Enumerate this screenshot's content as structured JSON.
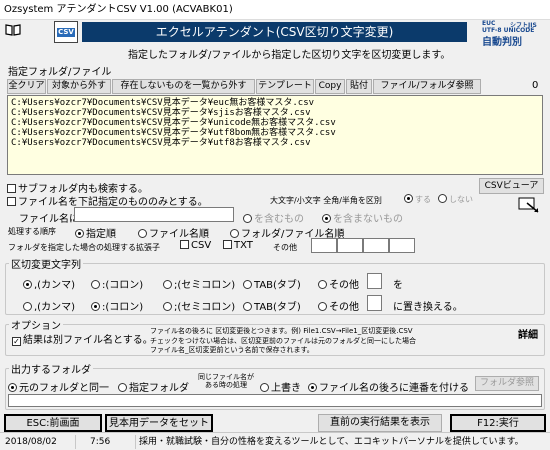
{
  "window_title": "Ozsystem アテンダントCSV V1.00 (ACVABK01)",
  "header": {
    "banner": "エクセルアテンダント(CSV区切り文字変更)",
    "badge": "CSV",
    "logo_top_left": "EUC",
    "logo_top_right": "シフトJIS",
    "logo_mid": "UTF-8 UNICODE",
    "logo_big": "自動判別",
    "description": "指定したフォルダ/ファイルから指定した区切り文字を区切変更します。"
  },
  "folder_section": {
    "label": "指定フォルダ/ファイル",
    "count": "0",
    "buttons": [
      "全クリア",
      "対象から外す",
      "存在しないものを一覧から外す",
      "テンプレート",
      "Copy",
      "貼付",
      "ファイル/フォルダ参照"
    ],
    "paths": [
      "C:¥Users¥ozcr7¥Documents¥CSV見本データ¥euc無お客様マスタ.csv",
      "C:¥Users¥ozcr7¥Documents¥CSV見本データ¥sjisお客様マスタ.csv",
      "C:¥Users¥ozcr7¥Documents¥CSV見本データ¥unicode無お客様マスタ.csv",
      "C:¥Users¥ozcr7¥Documents¥CSV見本データ¥utf8bom無お客様マスタ.csv",
      "C:¥Users¥ozcr7¥Documents¥CSV見本データ¥utf8お客様マスタ.csv"
    ]
  },
  "options": {
    "subfolder": "サブフォルダ内も検索する。",
    "filename_only": "ファイル名を下記指定のもののみとする。",
    "case_label": "大文字/小文字 全角/半角を区別",
    "case_yes": "する",
    "case_no": "しない",
    "csv_viewer": "CSVビューア",
    "filename_label": "ファイル名に",
    "contains": "を含むもの",
    "not_contains": "を含まないもの",
    "order_label": "処理する順序",
    "order_spec": "指定順",
    "order_name": "ファイル名順",
    "order_folder": "フォルダ/ファイル名順",
    "ext_label": "フォルダを指定した場合の処理する拡張子",
    "ext_csv": "CSV",
    "ext_txt": "TXT",
    "ext_other": "その他"
  },
  "delimiter_section": {
    "label": "区切変更文字列",
    "row1": [
      ",(カンマ)",
      ":(コロン)",
      ";(セミコロン)",
      "TAB(タブ)",
      "その他"
    ],
    "row1_suffix": "を",
    "row2": [
      ",(カンマ)",
      ":(コロン)",
      ";(セミコロン)",
      "TAB(タブ)",
      "その他"
    ],
    "row2_suffix": "に置き換える。"
  },
  "option_section": {
    "label": "オプション",
    "result_check": "結果は別ファイル名とする。",
    "note1": "ファイル名の後ろに 区切変更後とつきます。例) File1.CSV→File1_区切変更後.CSV",
    "note2": "チェックをつけない場合は、区切変更前のファイルは元のフォルダと同一にした場合",
    "note3": "ファイル名_区切変更前という名前で保存されます。",
    "detail": "詳細"
  },
  "output_section": {
    "label": "出力するフォルダ",
    "same": "元のフォルダと同一",
    "specified": "指定フォルダ",
    "dup_label": "同じファイル名がある時の処理",
    "overwrite": "上書き",
    "append": "ファイル名の後ろに連番を付ける",
    "browse": "フォルダ参照"
  },
  "footer": {
    "esc": "ESC:前画面",
    "sample": "見本用データをセット",
    "last_result": "直前の実行結果を表示",
    "f12": "F12:実行"
  },
  "status": {
    "date": "2018/08/02",
    "time": "7:56",
    "message": "採用・就職試験・自分の性格を変えるツールとして、エコキットパーソナルを提供しています。"
  }
}
